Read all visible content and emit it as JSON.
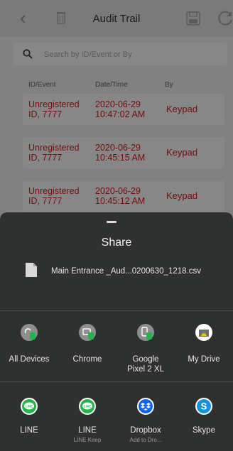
{
  "app": {
    "title": "Audit Trail",
    "search_placeholder": "Search by ID/Event or By",
    "columns": [
      "ID/Event",
      "Date/Time",
      "By"
    ],
    "rows": [
      {
        "event_line1": "Unregistered",
        "event_line2": "ID, 7777",
        "date": "2020-06-29",
        "time": "10:47:02 AM",
        "by": "Keypad"
      },
      {
        "event_line1": "Unregistered",
        "event_line2": "ID, 7777",
        "date": "2020-06-29",
        "time": "10:45:15 AM",
        "by": "Keypad"
      },
      {
        "event_line1": "Unregistered",
        "event_line2": "ID, 7777",
        "date": "2020-06-29",
        "time": "10:45:12 AM",
        "by": "Keypad"
      }
    ],
    "colors": {
      "event_text": "#d51d1d",
      "toolbar": "#e6e6e6"
    }
  },
  "share": {
    "title": "Share",
    "file_name": "Main Entrance _Aud...0200630_1218.csv",
    "row1": [
      {
        "label": "All Devices",
        "icon": "nearby-share-icon"
      },
      {
        "label": "Chrome",
        "icon": "chrome-send-icon"
      },
      {
        "label": "Google Pixel 2 XL",
        "label_line1": "Google",
        "label_line2": "Pixel 2 XL",
        "icon": "device-send-icon"
      },
      {
        "label": "My Drive",
        "icon": "google-drive-icon"
      }
    ],
    "row2": [
      {
        "label": "LINE",
        "sub": "",
        "icon": "line-icon"
      },
      {
        "label": "LINE",
        "sub": "LINE Keep",
        "icon": "line-keep-icon"
      },
      {
        "label": "Dropbox",
        "sub": "Add to Dro...",
        "icon": "dropbox-icon"
      },
      {
        "label": "Skype",
        "sub": "",
        "icon": "skype-icon"
      }
    ],
    "colors": {
      "sheet_bg": "#2f3131",
      "line_green": "#21b54b",
      "dropbox_blue": "#0d63f5",
      "skype_blue": "#1593dd"
    }
  }
}
